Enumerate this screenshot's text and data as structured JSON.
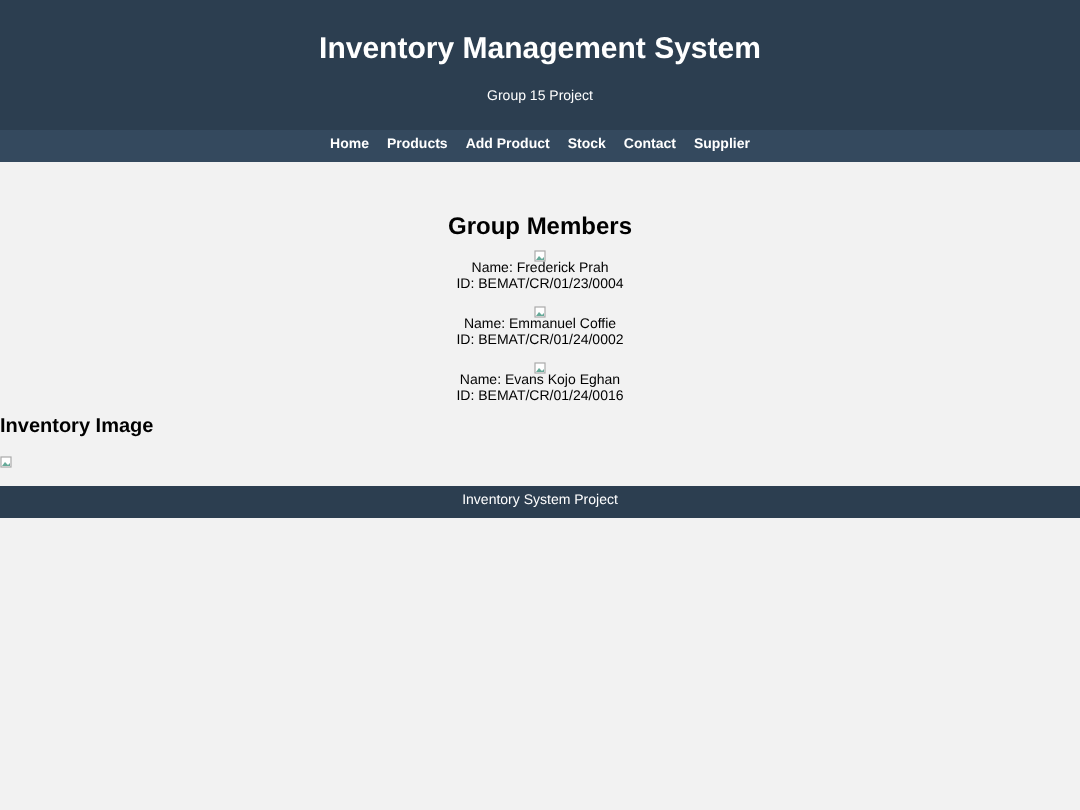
{
  "header": {
    "title": "Inventory Management System",
    "subtitle": "Group 15 Project"
  },
  "nav": [
    "Home",
    "Products",
    "Add Product",
    "Stock",
    "Contact",
    "Supplier"
  ],
  "members": {
    "title": "Group Members",
    "items": [
      {
        "name": "Name: Frederick Prah",
        "id": "ID: BEMAT/CR/01/23/0004"
      },
      {
        "name": "Name: Emmanuel Coffie",
        "id": "ID: BEMAT/CR/01/24/0002"
      },
      {
        "name": "Name: Evans Kojo Eghan",
        "id": "ID: BEMAT/CR/01/24/0016"
      }
    ]
  },
  "inventory": {
    "title": "Inventory Image"
  },
  "footer": "Inventory System Project"
}
